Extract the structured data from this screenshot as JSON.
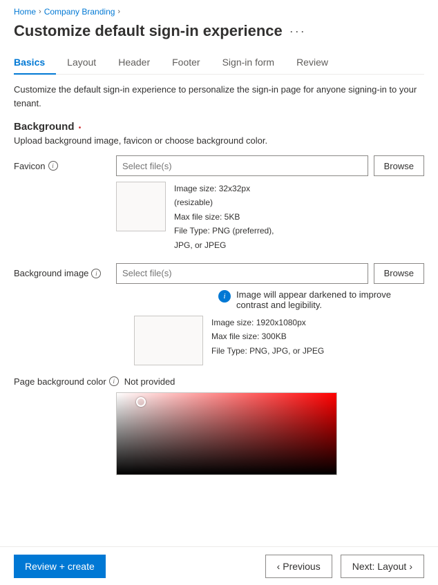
{
  "breadcrumb": {
    "home": "Home",
    "company_branding": "Company Branding",
    "chevron": "›"
  },
  "page_title": "Customize default sign-in experience",
  "more_icon": "···",
  "tabs": [
    {
      "label": "Basics",
      "active": true
    },
    {
      "label": "Layout",
      "active": false
    },
    {
      "label": "Header",
      "active": false
    },
    {
      "label": "Footer",
      "active": false
    },
    {
      "label": "Sign-in form",
      "active": false
    },
    {
      "label": "Review",
      "active": false
    }
  ],
  "description": "Customize the default sign-in experience to personalize the sign-in page for anyone signing-in to your tenant.",
  "background_section": {
    "title": "Background",
    "sub_text": "Upload background image, favicon or choose background color."
  },
  "favicon": {
    "label": "Favicon",
    "placeholder": "Select file(s)",
    "browse_label": "Browse",
    "image_size": "Image size: 32x32px",
    "resizable": "(resizable)",
    "max_file_size": "Max file size: 5KB",
    "file_type": "File Type: PNG (preferred),",
    "file_type2": "JPG, or JPEG"
  },
  "background_image": {
    "label": "Background image",
    "placeholder": "Select file(s)",
    "browse_label": "Browse",
    "info_banner": "Image will appear darkened to improve contrast and legibility.",
    "image_size": "Image size: 1920x1080px",
    "max_file_size": "Max file size: 300KB",
    "file_type": "File Type: PNG, JPG, or JPEG"
  },
  "page_background_color": {
    "label": "Page background color",
    "value": "Not provided"
  },
  "bottom_bar": {
    "review_create": "Review + create",
    "previous": "Previous",
    "next": "Next: Layout"
  },
  "icons": {
    "info": "i",
    "chevron_left": "‹",
    "chevron_right": "›"
  }
}
